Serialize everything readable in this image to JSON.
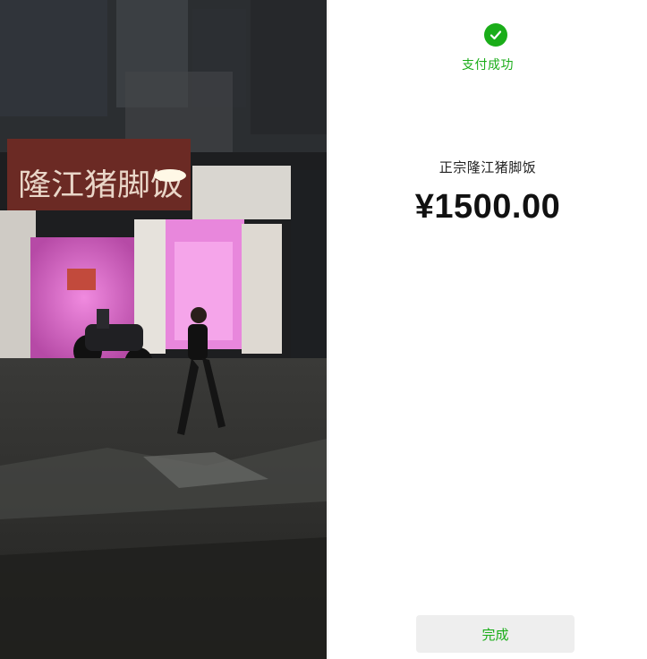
{
  "payment": {
    "status_text": "支付成功",
    "merchant_name": "正宗隆江猪脚饭",
    "amount": "¥1500.00",
    "done_label": "完成",
    "accent_color": "#1aad19"
  },
  "photo": {
    "sign_text": "隆江猪脚饭"
  },
  "icons": {
    "success": "checkmark-icon"
  }
}
